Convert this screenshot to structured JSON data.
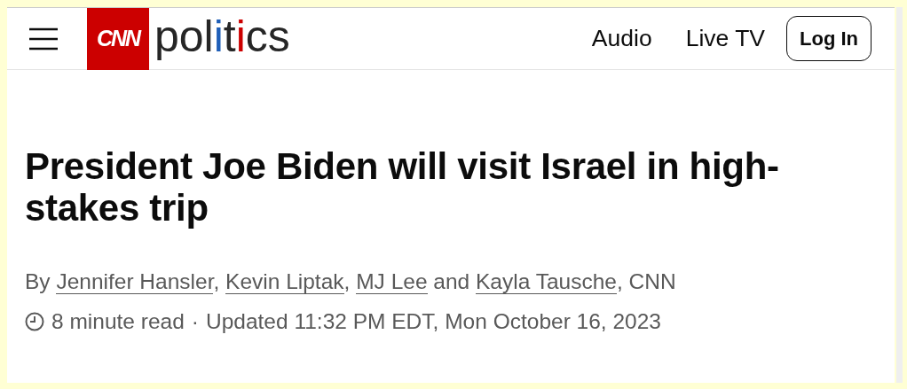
{
  "header": {
    "logo": "CNN",
    "wordmark": [
      {
        "text": "pol"
      },
      {
        "text": "i",
        "color": "#1f5fb8"
      },
      {
        "text": "t"
      },
      {
        "text": "i",
        "color": "#cc0000"
      },
      {
        "text": "cs"
      }
    ],
    "nav": [
      "Audio",
      "Live TV"
    ],
    "login": "Log In"
  },
  "article": {
    "headline": "President Joe Biden will visit Israel in high-stakes trip",
    "byline": {
      "prefix": "By",
      "authors": [
        {
          "name": "Jennifer Hansler",
          "sep": ", "
        },
        {
          "name": "Kevin Liptak",
          "sep": ", "
        },
        {
          "name": "MJ Lee",
          "sep": " and "
        },
        {
          "name": "Kayla Tausche",
          "sep": ", "
        }
      ],
      "suffix": "CNN"
    },
    "read_time": "8 minute read",
    "separator": "·",
    "updated": "Updated 11:32 PM EDT, Mon October 16, 2023"
  }
}
